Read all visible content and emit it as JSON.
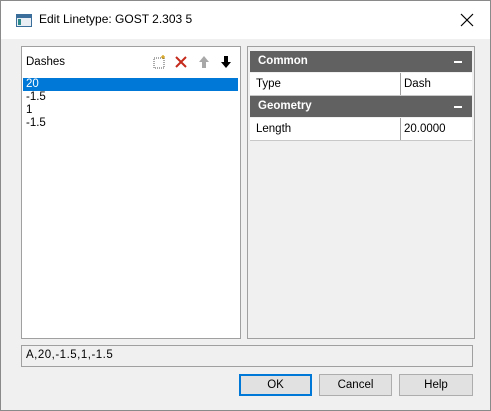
{
  "window": {
    "title": "Edit Linetype: GOST 2.303 5"
  },
  "dashes": {
    "label": "Dashes",
    "items": [
      "20",
      "-1.5",
      "1",
      "-1.5"
    ],
    "selected_index": 0
  },
  "toolbar": {
    "add_icon": "new-item-icon",
    "delete_icon": "delete-x-icon",
    "move_up_icon": "arrow-up-icon",
    "move_down_icon": "arrow-down-icon"
  },
  "properties": {
    "common": {
      "label": "Common",
      "rows": [
        {
          "name": "Type",
          "value": "Dash"
        }
      ]
    },
    "geometry": {
      "label": "Geometry",
      "rows": [
        {
          "name": "Length",
          "value": "20.0000"
        }
      ]
    }
  },
  "status": {
    "definition": "A,20,-1.5,1,-1.5"
  },
  "buttons": {
    "ok": "OK",
    "cancel": "Cancel",
    "help": "Help"
  },
  "colors": {
    "selection": "#0078d7",
    "category_header": "#616161",
    "delete": "#c42b1c"
  }
}
